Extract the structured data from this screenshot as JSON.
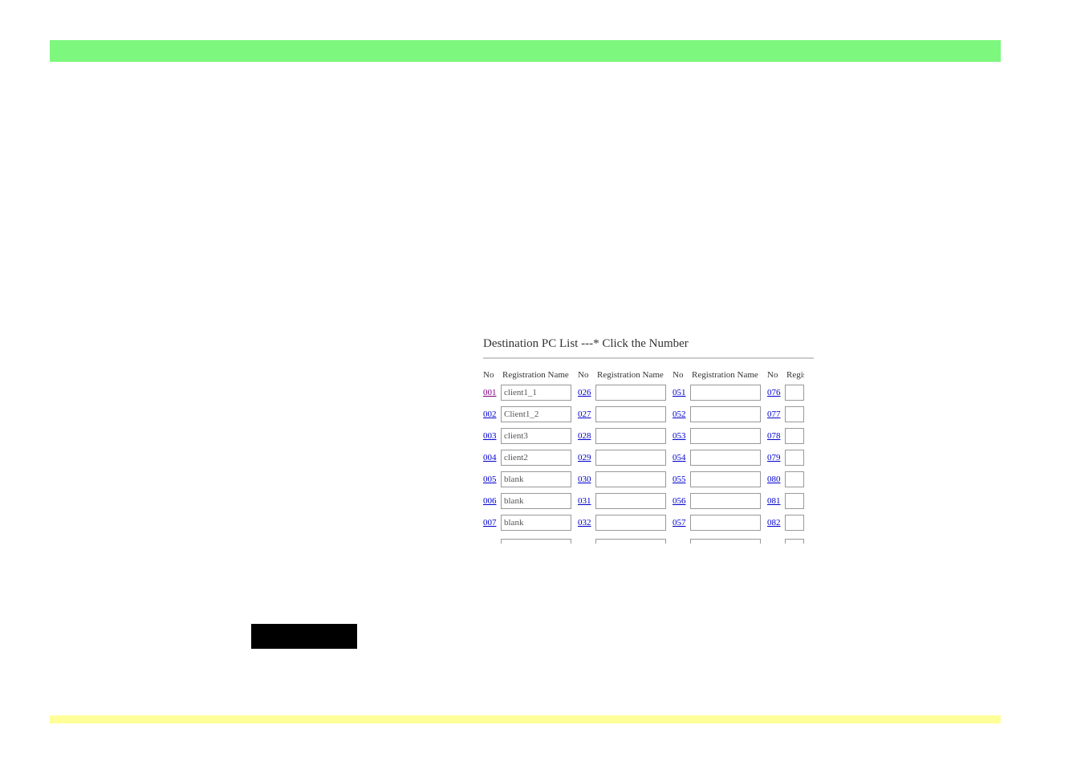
{
  "panel": {
    "title": "Destination PC List ---* Click the Number",
    "headers": {
      "no": "No",
      "name": "Registration Name",
      "regis_trunc": "Regis"
    },
    "columns": [
      [
        {
          "num": "001",
          "name": "client1_1",
          "visited": true
        },
        {
          "num": "002",
          "name": "Client1_2",
          "visited": false
        },
        {
          "num": "003",
          "name": "client3",
          "visited": false
        },
        {
          "num": "004",
          "name": "client2",
          "visited": false
        },
        {
          "num": "005",
          "name": "blank",
          "visited": false
        },
        {
          "num": "006",
          "name": "blank",
          "visited": false
        },
        {
          "num": "007",
          "name": "blank",
          "visited": false
        }
      ],
      [
        {
          "num": "026",
          "name": "",
          "visited": false
        },
        {
          "num": "027",
          "name": "",
          "visited": false
        },
        {
          "num": "028",
          "name": "",
          "visited": false
        },
        {
          "num": "029",
          "name": "",
          "visited": false
        },
        {
          "num": "030",
          "name": "",
          "visited": false
        },
        {
          "num": "031",
          "name": "",
          "visited": false
        },
        {
          "num": "032",
          "name": "",
          "visited": false
        }
      ],
      [
        {
          "num": "051",
          "name": "",
          "visited": false
        },
        {
          "num": "052",
          "name": "",
          "visited": false
        },
        {
          "num": "053",
          "name": "",
          "visited": false
        },
        {
          "num": "054",
          "name": "",
          "visited": false
        },
        {
          "num": "055",
          "name": "",
          "visited": false
        },
        {
          "num": "056",
          "name": "",
          "visited": false
        },
        {
          "num": "057",
          "name": "",
          "visited": false
        }
      ],
      [
        {
          "num": "076",
          "name": "",
          "visited": false
        },
        {
          "num": "077",
          "name": "",
          "visited": false
        },
        {
          "num": "078",
          "name": "",
          "visited": false
        },
        {
          "num": "079",
          "name": "",
          "visited": false
        },
        {
          "num": "080",
          "name": "",
          "visited": false
        },
        {
          "num": "081",
          "name": "",
          "visited": false
        },
        {
          "num": "082",
          "name": "",
          "visited": false
        }
      ]
    ]
  }
}
